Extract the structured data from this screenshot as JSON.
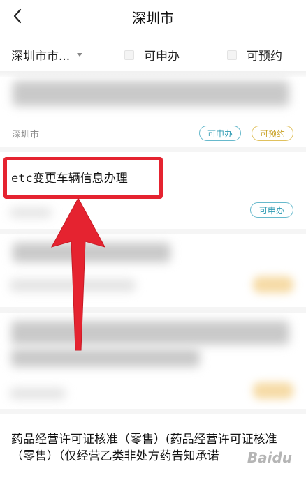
{
  "header": {
    "title": "深圳市",
    "back_icon": "chevron-left-icon"
  },
  "filters": {
    "city": "深圳市市...",
    "options": [
      {
        "label": "可申办"
      },
      {
        "label": "可预约"
      }
    ]
  },
  "items": [
    {
      "meta": "深圳市",
      "tags": [
        {
          "label": "可申办",
          "color": "#2f9bb3"
        },
        {
          "label": "可预约",
          "color": "#c9a227"
        }
      ]
    },
    {
      "title": "etc变更车辆信息办理",
      "tags": [
        {
          "label": "可申办",
          "color": "#2f9bb3"
        }
      ]
    },
    {
      "title": "药品经营许可证核准（零售）(药品经营许可证核准（零售）（仅经营乙类非处方药告知承诺"
    }
  ],
  "annotation": {
    "box_color": "#e52330",
    "arrow_color": "#e52330"
  }
}
